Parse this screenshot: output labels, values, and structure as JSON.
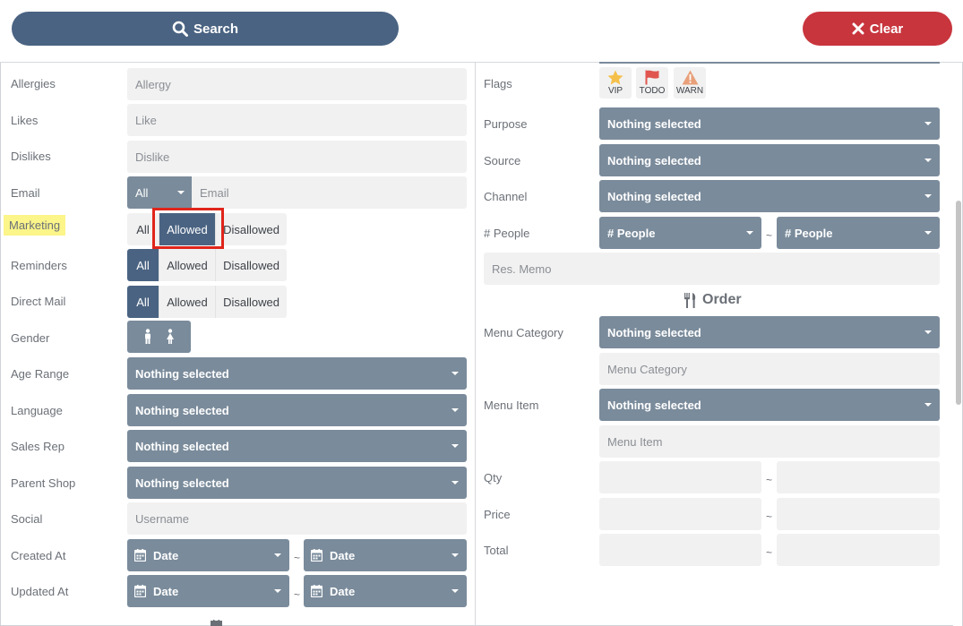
{
  "toolbar": {
    "search_label": "Search",
    "clear_label": "Clear",
    "colors": {
      "search_bg": "#4a6382",
      "clear_bg": "#c8353d"
    }
  },
  "left": {
    "allergies": {
      "label": "Allergies",
      "placeholder": "Allergy"
    },
    "likes": {
      "label": "Likes",
      "placeholder": "Like"
    },
    "dislikes": {
      "label": "Dislikes",
      "placeholder": "Dislike"
    },
    "email": {
      "label": "Email",
      "filter_value": "All",
      "placeholder": "Email"
    },
    "marketing": {
      "label": "Marketing",
      "options": [
        "All",
        "Allowed",
        "Disallowed"
      ],
      "selected": "Allowed"
    },
    "reminders": {
      "label": "Reminders",
      "options": [
        "All",
        "Allowed",
        "Disallowed"
      ],
      "selected": "All"
    },
    "direct_mail": {
      "label": "Direct Mail",
      "options": [
        "All",
        "Allowed",
        "Disallowed"
      ],
      "selected": "All"
    },
    "gender": {
      "label": "Gender",
      "icons": [
        "male-icon",
        "female-icon"
      ]
    },
    "age_range": {
      "label": "Age Range",
      "value": "Nothing selected"
    },
    "language": {
      "label": "Language",
      "value": "Nothing selected"
    },
    "sales_rep": {
      "label": "Sales Rep",
      "value": "Nothing selected"
    },
    "parent_shop": {
      "label": "Parent Shop",
      "value": "Nothing selected"
    },
    "social": {
      "label": "Social",
      "placeholder": "Username"
    },
    "created_at": {
      "label": "Created At",
      "from": "Date",
      "to": "Date",
      "separator": "~"
    },
    "updated_at": {
      "label": "Updated At",
      "from": "Date",
      "to": "Date",
      "separator": "~"
    }
  },
  "right": {
    "flags": {
      "label": "Flags",
      "items": [
        {
          "text": "VIP",
          "icon": "star-icon",
          "color": "#f5c04a"
        },
        {
          "text": "TODO",
          "icon": "flag-icon",
          "color": "#e0564f"
        },
        {
          "text": "WARN",
          "icon": "warning-icon",
          "color": "#e8a07a"
        }
      ]
    },
    "purpose": {
      "label": "Purpose",
      "value": "Nothing selected"
    },
    "source": {
      "label": "Source",
      "value": "Nothing selected"
    },
    "channel": {
      "label": "Channel",
      "value": "Nothing selected"
    },
    "people": {
      "label": "# People",
      "from": "# People",
      "to": "# People",
      "separator": "~"
    },
    "res_memo": {
      "placeholder": "Res. Memo"
    },
    "order_heading": "Order",
    "menu_category": {
      "label": "Menu Category",
      "value": "Nothing selected",
      "placeholder": "Menu Category"
    },
    "menu_item": {
      "label": "Menu Item",
      "value": "Nothing selected",
      "placeholder": "Menu Item"
    },
    "qty": {
      "label": "Qty",
      "separator": "~"
    },
    "price": {
      "label": "Price",
      "separator": "~"
    },
    "total": {
      "label": "Total",
      "separator": "~"
    }
  }
}
